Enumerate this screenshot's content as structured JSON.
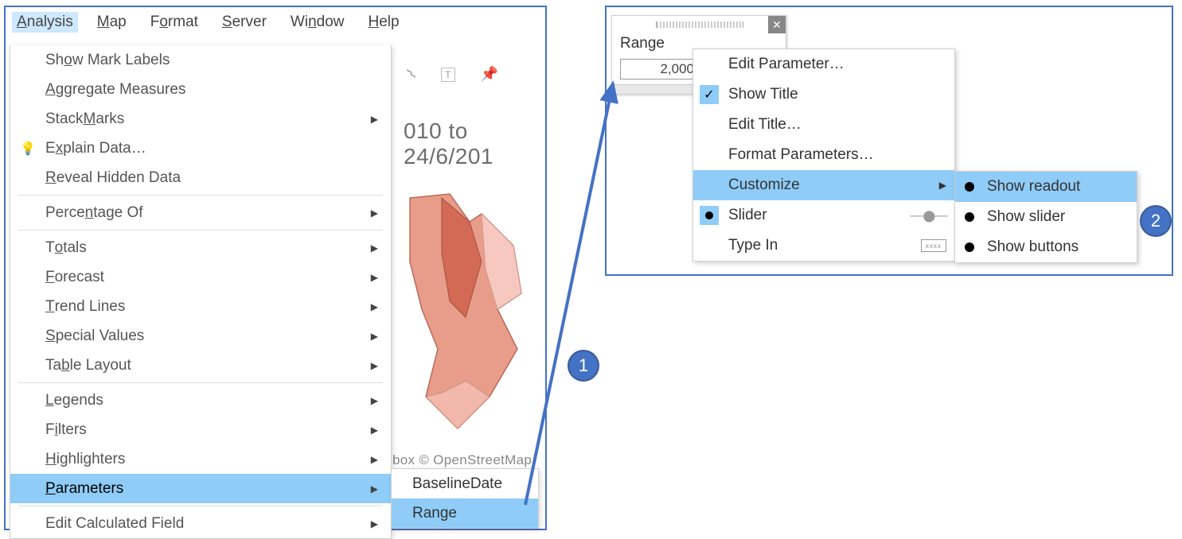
{
  "menubar": {
    "analysis": "Analysis",
    "map": "Map",
    "format": "Format",
    "server": "Server",
    "window": "Window",
    "help": "Help"
  },
  "analysis_menu": {
    "show_mark_labels": "Show Mark Labels",
    "aggregate_measures": "Aggregate Measures",
    "stack_marks": "Stack Marks",
    "explain_data": "Explain Data…",
    "reveal_hidden": "Reveal Hidden Data",
    "percentage_of": "Percentage Of",
    "totals": "Totals",
    "forecast": "Forecast",
    "trend_lines": "Trend Lines",
    "special_values": "Special Values",
    "table_layout": "Table Layout",
    "legends": "Legends",
    "filters": "Filters",
    "highlighters": "Highlighters",
    "parameters": "Parameters",
    "edit_calc_field": "Edit Calculated Field"
  },
  "parameters_submenu": {
    "baseline_date": "BaselineDate",
    "range": "Range"
  },
  "bg": {
    "title_fragment": "010 to 24/6/201",
    "attrib_fragment": "box © OpenStreetMap"
  },
  "param_card": {
    "title": "Range",
    "value": "2,000"
  },
  "context_menu": {
    "edit_parameter": "Edit Parameter…",
    "show_title": "Show Title",
    "edit_title": "Edit Title…",
    "format_parameters": "Format Parameters…",
    "customize": "Customize",
    "slider": "Slider",
    "type_in": "Type In"
  },
  "customize_submenu": {
    "show_readout": "Show readout",
    "show_slider": "Show slider",
    "show_buttons": "Show buttons"
  },
  "badges": {
    "one": "1",
    "two": "2"
  }
}
